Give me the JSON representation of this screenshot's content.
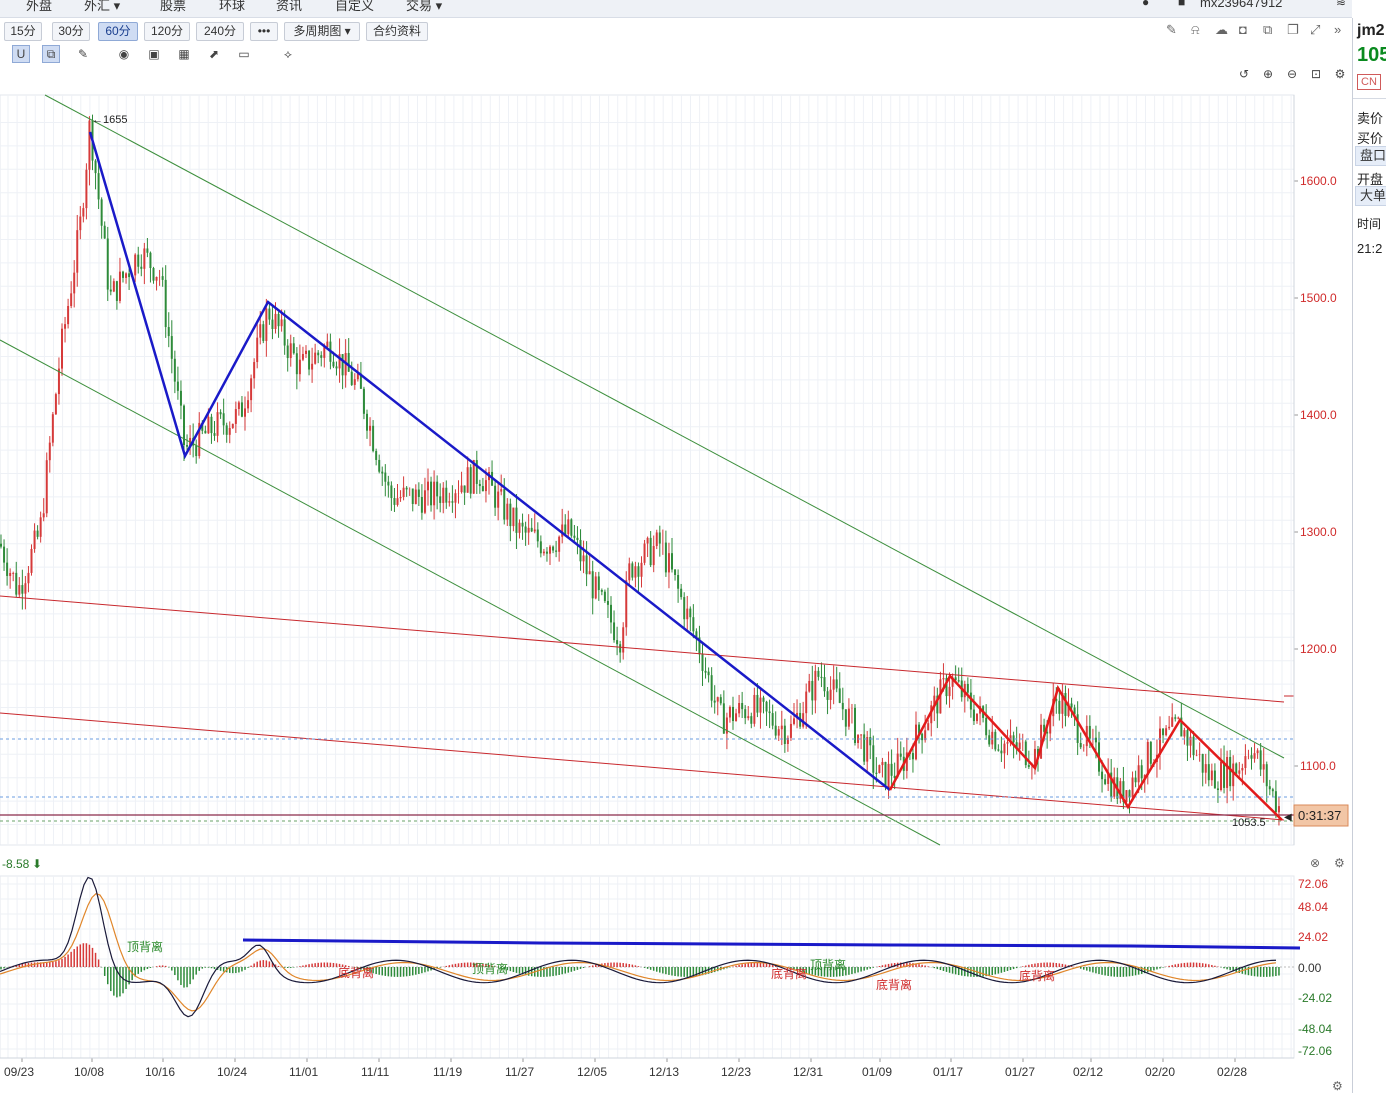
{
  "topnav": {
    "items": [
      "外盘",
      "外汇 ▾",
      "股票",
      "环球",
      "资讯",
      "自定义",
      "交易 ▾"
    ],
    "account": "mx239647912"
  },
  "periods": [
    "15分",
    "30分",
    "60分",
    "120分",
    "240分",
    "•••",
    "多周期图 ▾",
    "合约资料"
  ],
  "active_period": "60分",
  "right": {
    "code": "jm2",
    "price": "105",
    "cn": "CN",
    "sell": "卖价",
    "buy": "买价",
    "depth": "盘口",
    "open": "开盘",
    "big": "大单",
    "time_label": "时间",
    "time_value": "21:2"
  },
  "price_axis": [
    "1600.0",
    "1500.0",
    "1400.0",
    "1300.0",
    "1200.0",
    "1100.0"
  ],
  "countdown": "0:31:37",
  "low_label": "1053.5",
  "high_label": "←1655",
  "indicator": {
    "readout": "-8.58",
    "axis": [
      "72.06",
      "48.04",
      "24.02",
      "0.00",
      "-24.02",
      "-48.04",
      "-72.06"
    ]
  },
  "annotations": {
    "top_div": "顶背离",
    "bottom_div": "底背离"
  },
  "x_axis": [
    "09/23",
    "10/08",
    "10/16",
    "10/24",
    "11/01",
    "11/11",
    "11/19",
    "11/27",
    "12/05",
    "12/13",
    "12/23",
    "12/31",
    "01/09",
    "01/17",
    "01/27",
    "02/12",
    "02/20",
    "02/28"
  ],
  "chart_data": {
    "type": "candlestick",
    "ylim": [
      1040,
      1680
    ],
    "high": 1655,
    "low": 1053.5,
    "zigzag_points_blue": [
      [
        1,
        1640
      ],
      [
        2,
        1365
      ],
      [
        3,
        1497
      ],
      [
        11,
        1077
      ]
    ],
    "zigzag_points_red": [
      [
        12,
        1176
      ],
      [
        13,
        1100
      ],
      [
        14,
        1166
      ],
      [
        15,
        1050
      ],
      [
        16,
        1137
      ],
      [
        17,
        1053.5
      ]
    ],
    "colors": {
      "up": "#d63a3a",
      "down": "#2e8b3a",
      "zigzag_blue": "#1a1ac8",
      "zigzag_red": "#e31b1b",
      "channel_green": "#3d8f3d",
      "trend_red": "#c8282d"
    }
  }
}
